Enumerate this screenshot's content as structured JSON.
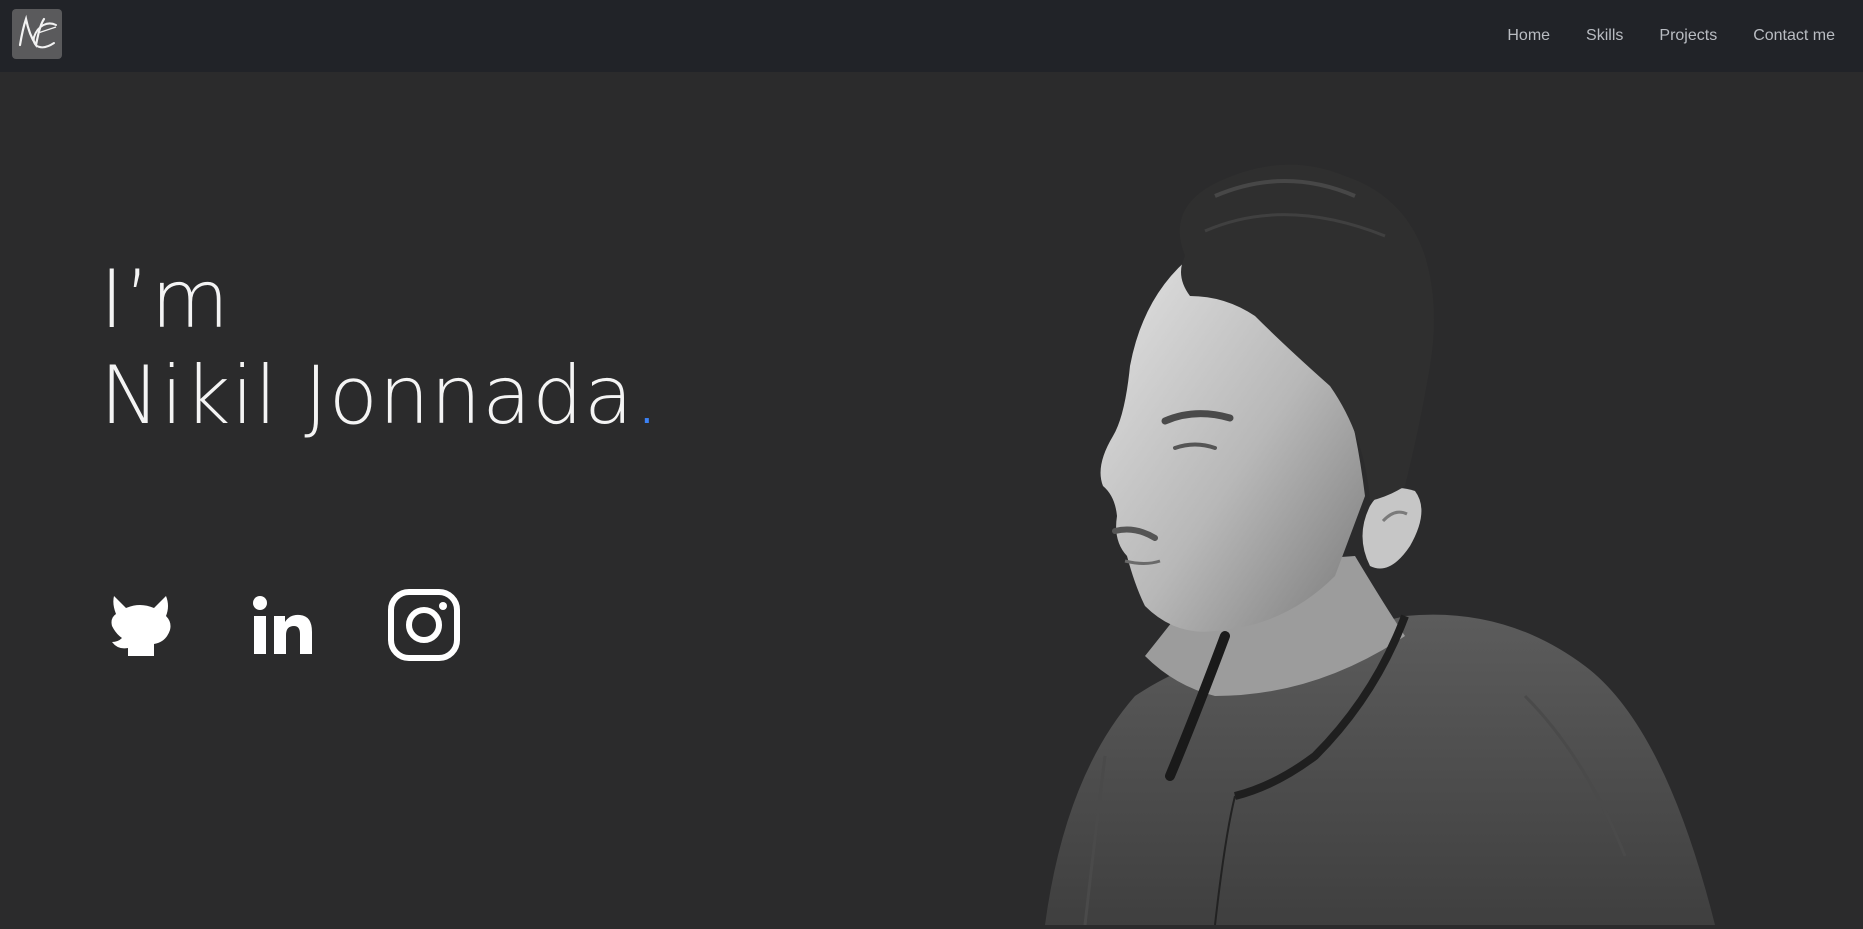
{
  "nav": {
    "logo": {
      "icon": "nc-monogram-logo",
      "text": "NC"
    },
    "links": [
      "Home",
      "Skills",
      "Projects",
      "Contact me"
    ]
  },
  "hero": {
    "greeting": "I’m",
    "name": "Nikil Jonnada",
    "accent_dot": ".",
    "socials": [
      {
        "icon": "github-icon"
      },
      {
        "icon": "linkedin-icon"
      },
      {
        "icon": "instagram-icon"
      }
    ],
    "portrait": {
      "description": "grayscale profile photo"
    }
  },
  "colors": {
    "background": "#2b2b2c",
    "navbar": "#212328",
    "text": "#f4f4f4",
    "nav_text": "#b9bcc2",
    "accent": "#3b82f6"
  }
}
